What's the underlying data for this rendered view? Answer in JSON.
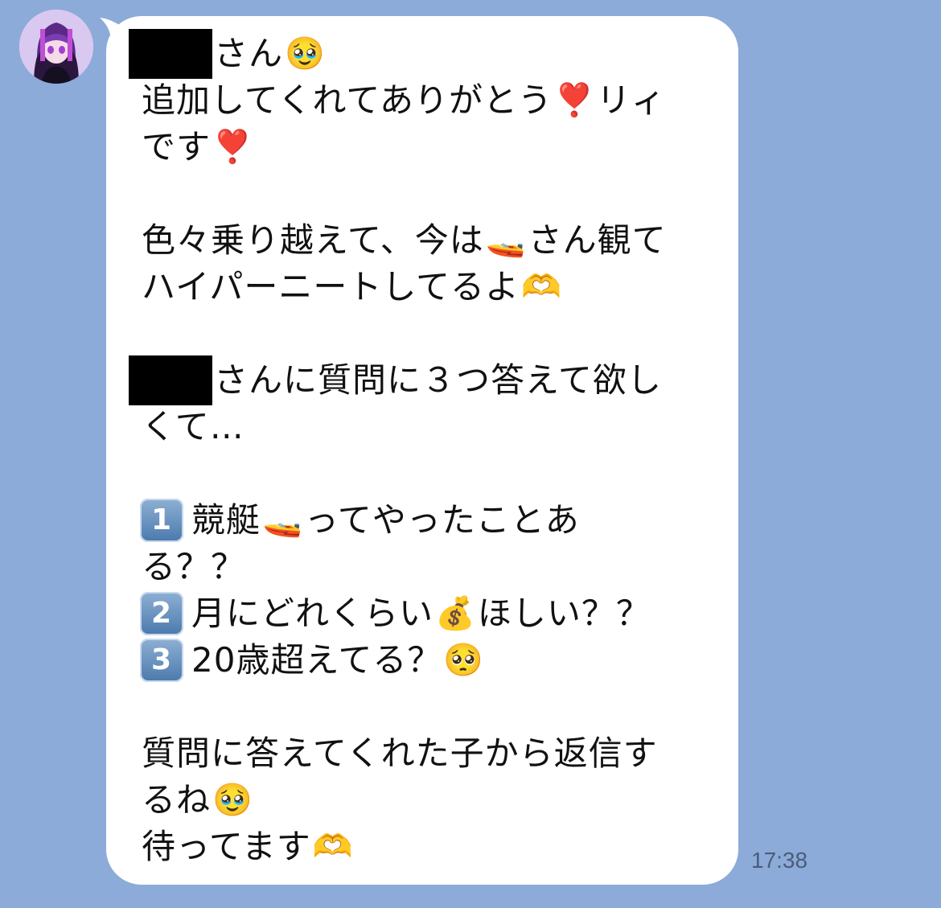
{
  "chat": {
    "message": {
      "l1": "さん",
      "l1_emoji": "🥹",
      "l2a": "追加してくれてありがとう",
      "l2_emoji": "❣️",
      "l2b": "リィ",
      "l3a": "です",
      "l3_emoji": "❣️",
      "l5a": "色々乗り越えて、今は",
      "l5_emoji": "🚤",
      "l5b": "さん観て",
      "l6a": "ハイパーニートしてるよ",
      "l6_emoji": "🫶",
      "l8": "さんに質問に３つ答えて欲し",
      "l9": "くて…",
      "q1_num": "1",
      "q1a": "競艇",
      "q1_emoji": "🚤",
      "q1b": "ってやったことあ",
      "q1c": "る？？",
      "q2_num": "2",
      "q2a": "月にどれくらい",
      "q2_emoji": "💰",
      "q2b": "ほしい？？",
      "q3_num": "3",
      "q3a": "20歳超えてる？",
      "q3_emoji": "🥺",
      "l14": "質問に答えてくれた子から返信す",
      "l15": "るね",
      "l15_emoji": "🥹",
      "l16": "待ってます",
      "l16_emoji": "🫶"
    },
    "timestamp": "17:38"
  },
  "colors": {
    "background": "#8cabd9",
    "bubble": "#ffffff",
    "text": "#111111",
    "timestamp": "#4b5d79"
  },
  "icons": {
    "avatar": "anime-girl-avatar"
  }
}
